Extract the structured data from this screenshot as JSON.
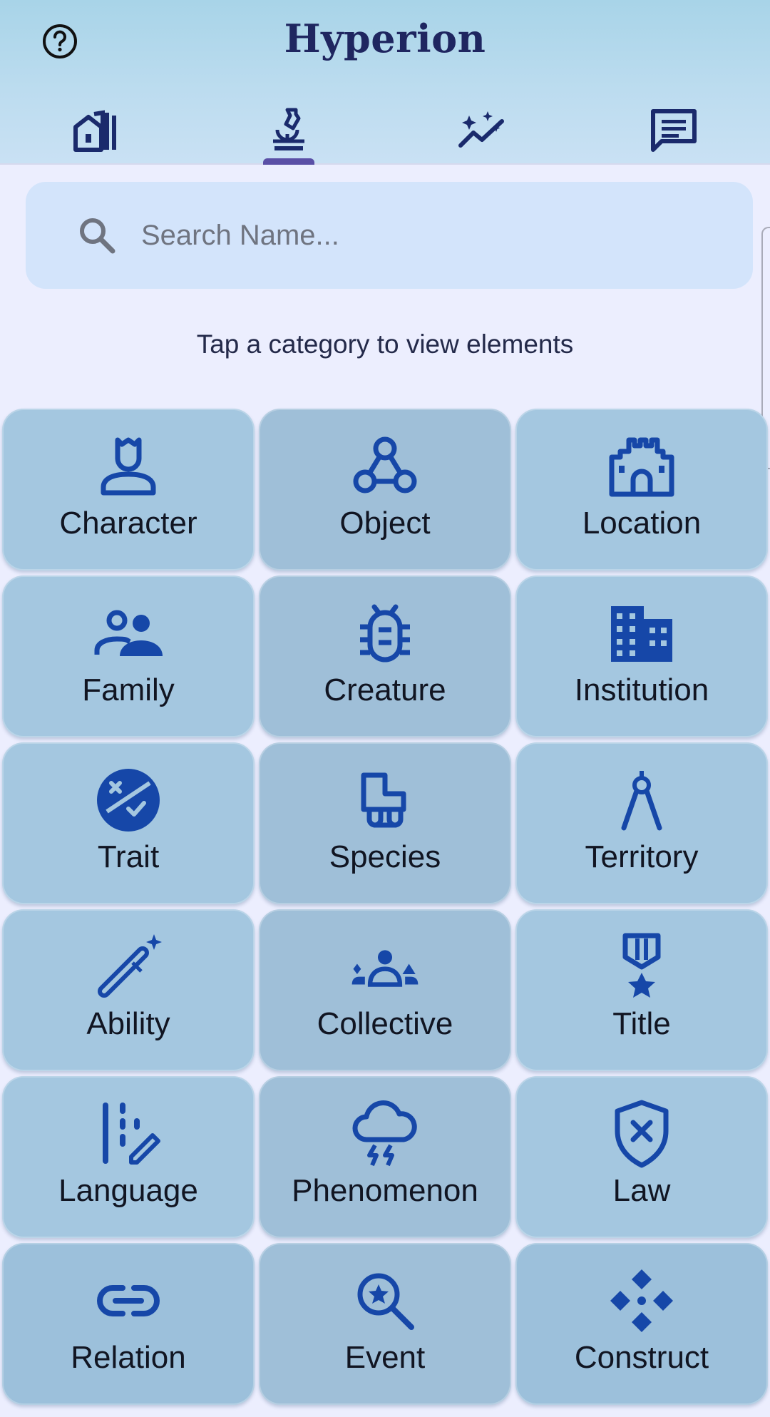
{
  "header": {
    "title": "Hyperion",
    "help_icon": "help-circle-icon",
    "tabs": [
      {
        "icon": "buildings-icon",
        "active": false
      },
      {
        "icon": "microscope-icon",
        "active": true
      },
      {
        "icon": "sparkle-trend-icon",
        "active": false
      },
      {
        "icon": "article-icon",
        "active": false
      }
    ]
  },
  "search": {
    "placeholder": "Search Name...",
    "value": ""
  },
  "hint": "Tap a category to view elements",
  "categories": [
    {
      "label": "Character",
      "icon": "person-crown-icon"
    },
    {
      "label": "Object",
      "icon": "webhook-icon"
    },
    {
      "label": "Location",
      "icon": "castle-icon"
    },
    {
      "label": "Family",
      "icon": "group-icon"
    },
    {
      "label": "Creature",
      "icon": "bug-icon"
    },
    {
      "label": "Institution",
      "icon": "building-icon"
    },
    {
      "label": "Trait",
      "icon": "face-dizzy-icon"
    },
    {
      "label": "Species",
      "icon": "chair-icon"
    },
    {
      "label": "Territory",
      "icon": "compass-drafting-icon"
    },
    {
      "label": "Ability",
      "icon": "magic-wand-icon"
    },
    {
      "label": "Collective",
      "icon": "groups-icon"
    },
    {
      "label": "Title",
      "icon": "military-medal-icon"
    },
    {
      "label": "Language",
      "icon": "edit-note-icon"
    },
    {
      "label": "Phenomenon",
      "icon": "thunderstorm-icon"
    },
    {
      "label": "Law",
      "icon": "gpp-bad-shield-icon"
    },
    {
      "label": "Relation",
      "icon": "link-icon"
    },
    {
      "label": "Event",
      "icon": "search-star-icon"
    },
    {
      "label": "Construct",
      "icon": "diamond-cluster-icon"
    }
  ],
  "colors": {
    "icon_blue": "#1647a8",
    "header_top": "#a8d4e8",
    "tile": "#a4c7e0",
    "accent": "#5a4fa6"
  }
}
